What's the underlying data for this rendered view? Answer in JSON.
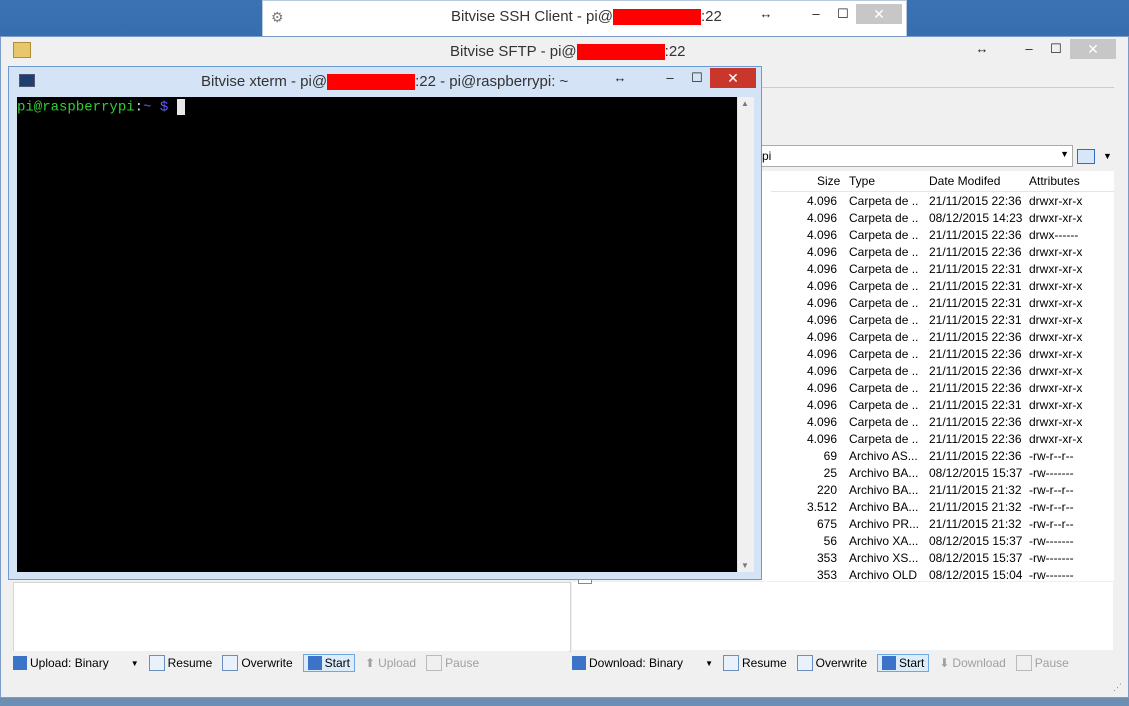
{
  "ssh_client": {
    "title_prefix": "Bitvise SSH Client - pi@",
    "title_suffix": ":22",
    "restore_glyph": "↔",
    "minimize_glyph": "–",
    "maximize_glyph": "☐",
    "close_glyph": "✕"
  },
  "sftp": {
    "title_prefix": "Bitvise SFTP - pi@",
    "title_suffix": ":22",
    "path_value": "pi",
    "columns": {
      "size": "Size",
      "type": "Type",
      "date": "Date Modifed",
      "attr": "Attributes"
    },
    "rows": [
      {
        "size": "4.096",
        "type": "Carpeta de ...",
        "date": "21/11/2015 22:36",
        "attr": "drwxr-xr-x"
      },
      {
        "size": "4.096",
        "type": "Carpeta de ...",
        "date": "08/12/2015 14:23",
        "attr": "drwxr-xr-x"
      },
      {
        "size": "4.096",
        "type": "Carpeta de ...",
        "date": "21/11/2015 22:36",
        "attr": "drwx------"
      },
      {
        "size": "4.096",
        "type": "Carpeta de ...",
        "date": "21/11/2015 22:36",
        "attr": "drwxr-xr-x"
      },
      {
        "size": "4.096",
        "type": "Carpeta de ...",
        "date": "21/11/2015 22:31",
        "attr": "drwxr-xr-x"
      },
      {
        "size": "4.096",
        "type": "Carpeta de ...",
        "date": "21/11/2015 22:31",
        "attr": "drwxr-xr-x"
      },
      {
        "size": "4.096",
        "type": "Carpeta de ...",
        "date": "21/11/2015 22:31",
        "attr": "drwxr-xr-x"
      },
      {
        "size": "4.096",
        "type": "Carpeta de ...",
        "date": "21/11/2015 22:31",
        "attr": "drwxr-xr-x"
      },
      {
        "size": "4.096",
        "type": "Carpeta de ...",
        "date": "21/11/2015 22:36",
        "attr": "drwxr-xr-x"
      },
      {
        "size": "4.096",
        "type": "Carpeta de ...",
        "date": "21/11/2015 22:36",
        "attr": "drwxr-xr-x"
      },
      {
        "size": "4.096",
        "type": "Carpeta de ...",
        "date": "21/11/2015 22:36",
        "attr": "drwxr-xr-x"
      },
      {
        "size": "4.096",
        "type": "Carpeta de ...",
        "date": "21/11/2015 22:36",
        "attr": "drwxr-xr-x"
      },
      {
        "size": "4.096",
        "type": "Carpeta de ...",
        "date": "21/11/2015 22:31",
        "attr": "drwxr-xr-x"
      },
      {
        "size": "4.096",
        "type": "Carpeta de ...",
        "date": "21/11/2015 22:36",
        "attr": "drwxr-xr-x"
      },
      {
        "size": "4.096",
        "type": "Carpeta de ...",
        "date": "21/11/2015 22:36",
        "attr": "drwxr-xr-x"
      },
      {
        "size": "69",
        "type": "Archivo AS...",
        "date": "21/11/2015 22:36",
        "attr": "-rw-r--r--"
      },
      {
        "size": "25",
        "type": "Archivo BA...",
        "date": "08/12/2015 15:37",
        "attr": "-rw-------"
      },
      {
        "size": "220",
        "type": "Archivo BA...",
        "date": "21/11/2015 21:32",
        "attr": "-rw-r--r--"
      },
      {
        "size": "3.512",
        "type": "Archivo BA...",
        "date": "21/11/2015 21:32",
        "attr": "-rw-r--r--"
      },
      {
        "size": "675",
        "type": "Archivo PR...",
        "date": "21/11/2015 21:32",
        "attr": "-rw-r--r--"
      },
      {
        "size": "56",
        "type": "Archivo XA...",
        "date": "08/12/2015 15:37",
        "attr": "-rw-------"
      },
      {
        "size": "353",
        "type": "Archivo XS...",
        "date": "08/12/2015 15:37",
        "attr": "-rw-------"
      },
      {
        "size": "353",
        "type": "Archivo OLD",
        "date": "08/12/2015 15:04",
        "attr": "-rw-------"
      }
    ],
    "left_toolbar": {
      "upload_mode": "Upload: Binary",
      "resume": "Resume",
      "overwrite": "Overwrite",
      "start": "Start",
      "upload": "Upload",
      "pause": "Pause"
    },
    "right_toolbar": {
      "download_mode": "Download: Binary",
      "resume": "Resume",
      "overwrite": "Overwrite",
      "start": "Start",
      "download": "Download",
      "pause": "Pause"
    }
  },
  "xterm": {
    "title_prefix": "Bitvise xterm - pi@",
    "title_suffix": ":22 - pi@raspberrypi: ~",
    "prompt_user": "pi@raspberrypi",
    "prompt_sep": ":",
    "prompt_path": "~",
    "prompt_symbol": "$"
  },
  "colors": {
    "prompt_green": "#32cd32",
    "prompt_blue": "#5c5cff",
    "redaction": "#ff0000"
  }
}
